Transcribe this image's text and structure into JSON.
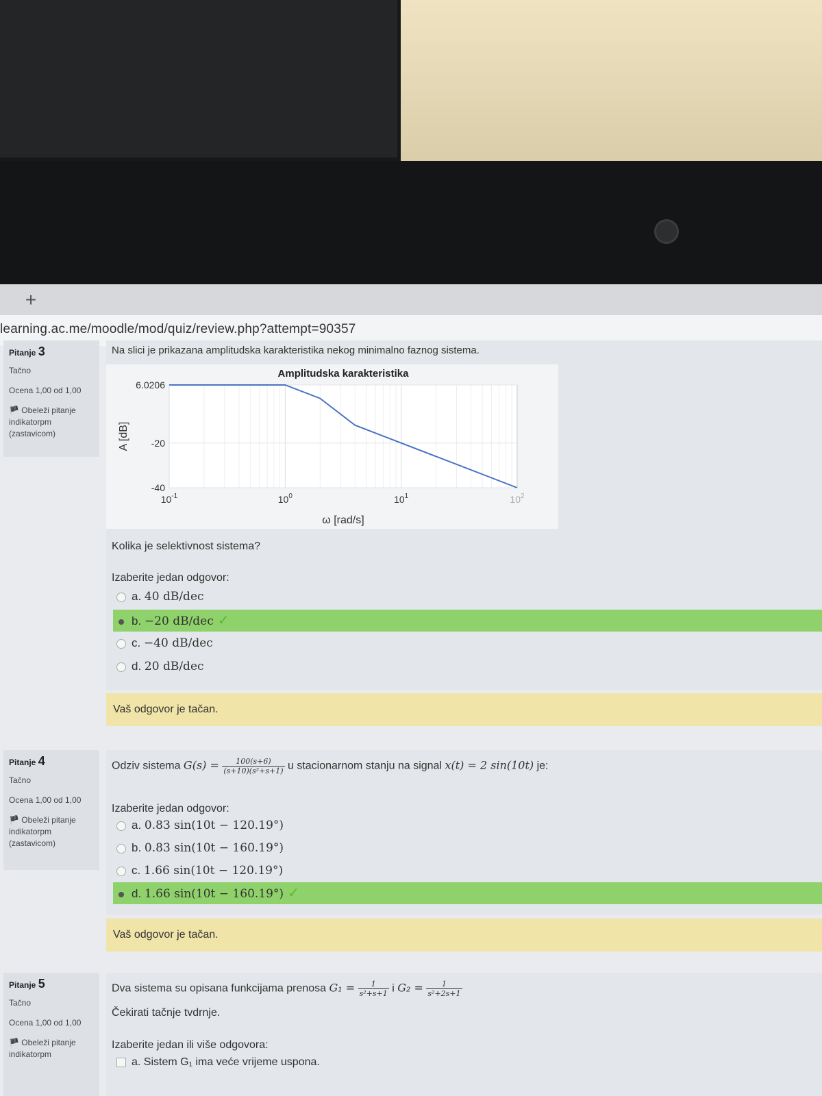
{
  "browser": {
    "new_tab": "+",
    "url": "learning.ac.me/moodle/mod/quiz/review.php?attempt=90357"
  },
  "q3": {
    "label": "Pitanje",
    "number": "3",
    "state": "Tačno",
    "grade": "Ocena 1,00 od 1,00",
    "flag": "Obeleži pitanje indikatorpm (zastavicom)",
    "text": "Na slici je prikazana amplitudska karakteristika nekog minimalno faznog sistema.",
    "question": "Kolika je selektivnost sistema?",
    "prompt": "Izaberite jedan odgovor:",
    "options": [
      {
        "letter": "a.",
        "value": "40 dB/dec"
      },
      {
        "letter": "b.",
        "value": "−20 dB/dec"
      },
      {
        "letter": "c.",
        "value": "−40 dB/dec"
      },
      {
        "letter": "d.",
        "value": "20 dB/dec"
      }
    ],
    "selected": "b",
    "feedback": "Vaš odgovor je tačan."
  },
  "chart_data": {
    "type": "line",
    "title": "Amplitudska karakteristika",
    "xlabel": "ω [rad/s]",
    "ylabel": "A [dB]",
    "x_scale": "log",
    "xlim": [
      0.1,
      100
    ],
    "ylim": [
      -40,
      6.0206
    ],
    "x_ticks": [
      "10^-1",
      "10^0",
      "10^1",
      "10^2"
    ],
    "y_ticks": [
      "6.0206",
      "-20",
      "-40"
    ],
    "grid": true,
    "series": [
      {
        "color": "#4a72c4",
        "x": [
          0.1,
          1,
          2,
          4,
          100
        ],
        "y": [
          6.0206,
          6.0206,
          0,
          -12,
          -40
        ]
      }
    ]
  },
  "q4": {
    "label": "Pitanje",
    "number": "4",
    "state": "Tačno",
    "grade": "Ocena 1,00 od 1,00",
    "flag": "Obeleži pitanje indikatorpm (zastavicom)",
    "text_pre": "Odziv sistema",
    "g_label": "G(s) =",
    "g_num": "100(s+6)",
    "g_den": "(s+10)(s²+s+1)",
    "text_post": "u stacionarnom stanju na signal",
    "signal": "x(t) = 2 sin(10t)",
    "text_end": "je:",
    "prompt": "Izaberite jedan odgovor:",
    "options": [
      {
        "letter": "a.",
        "value": "0.83 sin(10t − 120.19°)"
      },
      {
        "letter": "b.",
        "value": "0.83 sin(10t − 160.19°)"
      },
      {
        "letter": "c.",
        "value": "1.66 sin(10t − 120.19°)"
      },
      {
        "letter": "d.",
        "value": "1.66 sin(10t − 160.19°)"
      }
    ],
    "selected": "d",
    "feedback": "Vaš odgovor je tačan."
  },
  "q5": {
    "label": "Pitanje",
    "number": "5",
    "state": "Tačno",
    "grade": "Ocena 1,00 od 1,00",
    "flag": "Obeleži pitanje indikatorpm",
    "text_pre": "Dva sistema su opisana funkcijama prenosa",
    "g1_label": "G₁ =",
    "g1_num": "1",
    "g1_den": "s²+s+1",
    "conj": "i",
    "g2_label": "G₂ =",
    "g2_num": "1",
    "g2_den": "s²+2s+1",
    "instruction": "Čekirati tačnje tvdrnje.",
    "prompt": "Izaberite jedan ili više odgovora:",
    "option_a_letter": "a.",
    "option_a": "Sistem G₁ ima veće vrijeme uspona."
  }
}
